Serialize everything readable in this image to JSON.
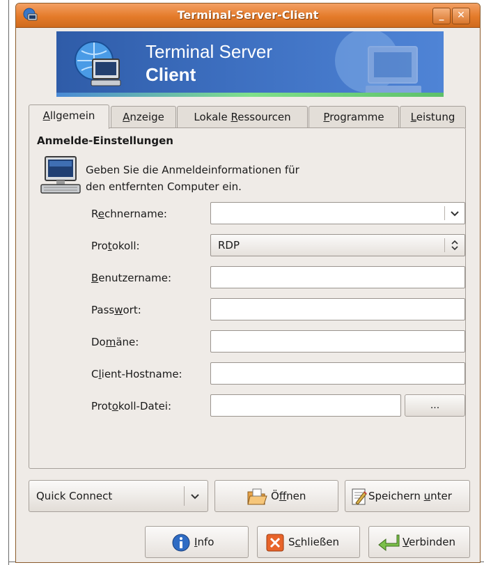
{
  "window": {
    "title": "Terminal-Server-Client"
  },
  "banner": {
    "line1": "Terminal Server",
    "line2": "Client"
  },
  "tabs": [
    {
      "pre": "",
      "u": "A",
      "post": "llgemein"
    },
    {
      "pre": "",
      "u": "A",
      "post": "nzeige"
    },
    {
      "pre": "Lokale ",
      "u": "R",
      "post": "essourcen"
    },
    {
      "pre": "",
      "u": "P",
      "post": "rogramme"
    },
    {
      "pre": "",
      "u": "L",
      "post": "eistung"
    }
  ],
  "section": {
    "title": "Anmelde-Einstellungen",
    "intro_line1": "Geben Sie die Anmeldeinformationen für",
    "intro_line2": "den entfernten Computer ein."
  },
  "fields": {
    "rechnername": {
      "pre": "R",
      "u": "e",
      "post": "chnername:",
      "value": ""
    },
    "protokoll": {
      "pre": "Pro",
      "u": "t",
      "post": "okoll:",
      "value": "RDP"
    },
    "benutzername": {
      "pre": "",
      "u": "B",
      "post": "enutzername:",
      "value": ""
    },
    "passwort": {
      "pre": "Pass",
      "u": "w",
      "post": "ort:",
      "value": ""
    },
    "domaene": {
      "pre": "Do",
      "u": "m",
      "post": "äne:",
      "value": ""
    },
    "client_hostname": {
      "pre": "C",
      "u": "l",
      "post": "ient-Hostname:",
      "value": ""
    },
    "protokoll_datei": {
      "pre": "Prot",
      "u": "o",
      "post": "koll-Datei:",
      "value": "",
      "browse_label": "..."
    }
  },
  "actions": {
    "quick_connect": "Quick Connect",
    "open": {
      "pre": "Ö",
      "u": "f",
      "post": "fnen"
    },
    "save_as": {
      "pre": "Speichern ",
      "u": "u",
      "post": "nter"
    },
    "info": {
      "pre": "",
      "u": "I",
      "post": "nfo"
    },
    "close": {
      "pre": "S",
      "u": "c",
      "post": "hließen"
    },
    "connect": {
      "pre": "",
      "u": "V",
      "post": "erbinden"
    }
  }
}
